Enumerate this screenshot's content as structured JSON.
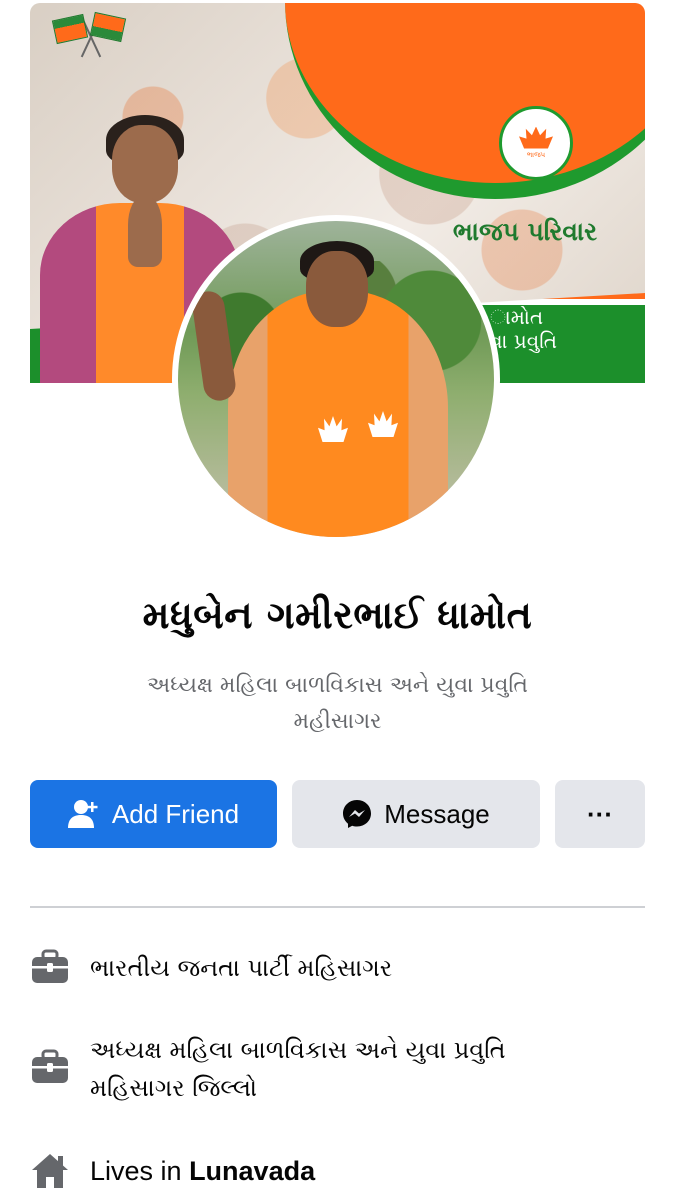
{
  "cover": {
    "banner_text": "ભાજપ પરિવાર",
    "side_text_line1": "ામોત",
    "side_text_line2": "વા પ્રવુતિ"
  },
  "profile": {
    "name": "મધુબેન ગમીરભાઈ ધામોત",
    "bio_line1": "અધ્યક્ષ મહિલા બાળવિકાસ અને યુવા પ્રવુતિ",
    "bio_line2": "મહીસાગર"
  },
  "actions": {
    "add_friend_label": "Add Friend",
    "message_label": "Message",
    "more_label": "···"
  },
  "details": [
    {
      "icon": "briefcase-icon",
      "text": "ભારતીય જનતા પાર્ટી મહિસાગર"
    },
    {
      "icon": "briefcase-icon",
      "text_line1": "અધ્યક્ષ મહિલા બાળવિકાસ અને યુવા પ્રવુતિ",
      "text_line2": "મહિસાગર જિલ્લો"
    },
    {
      "icon": "home-icon",
      "prefix": "Lives in",
      "place": "Lunavada"
    }
  ],
  "colors": {
    "primary": "#1b74e4",
    "secondary_button": "#e4e6eb",
    "muted_text": "#65676b",
    "icon_gray": "#65676b"
  }
}
